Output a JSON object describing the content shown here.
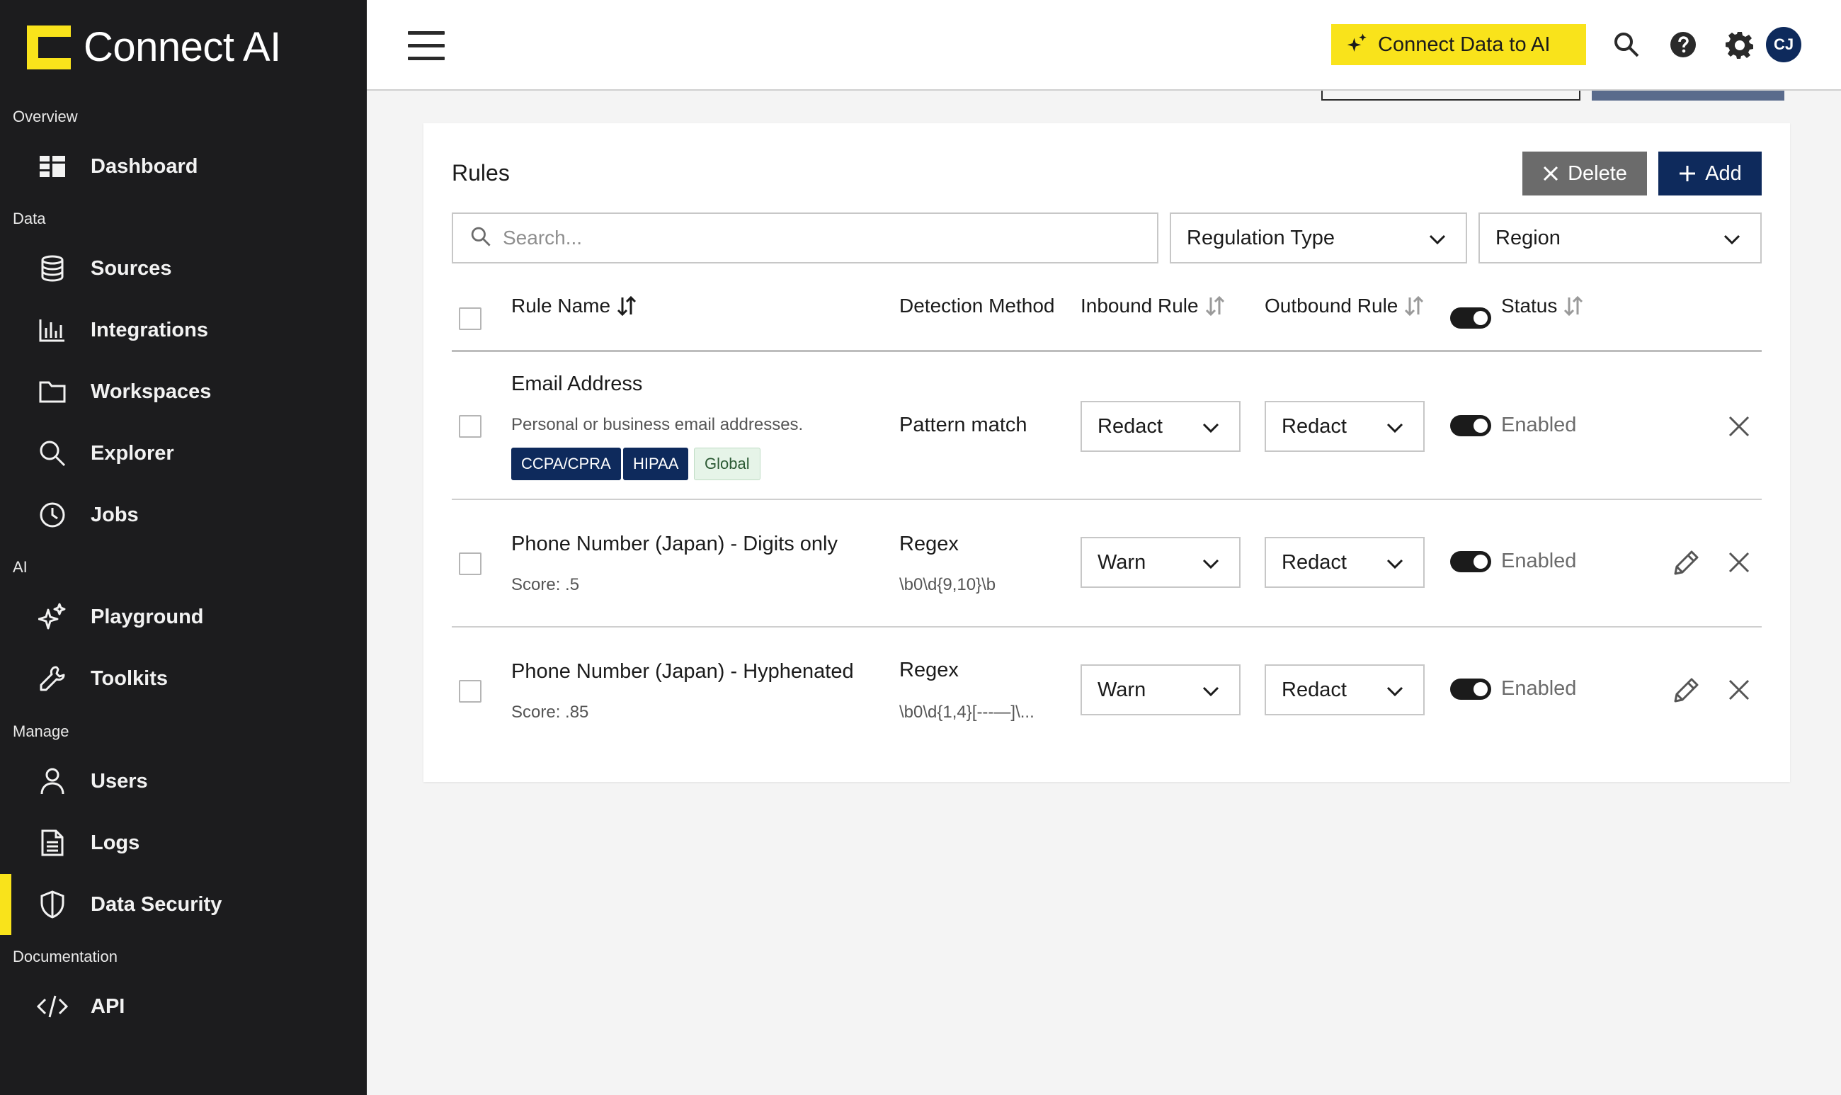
{
  "sidebar": {
    "brand": "Connect AI",
    "sections": {
      "overview": "Overview",
      "data": "Data",
      "ai": "AI",
      "manage": "Manage",
      "documentation": "Documentation"
    },
    "items": {
      "dashboard": "Dashboard",
      "sources": "Sources",
      "integrations": "Integrations",
      "workspaces": "Workspaces",
      "explorer": "Explorer",
      "jobs": "Jobs",
      "playground": "Playground",
      "toolkits": "Toolkits",
      "users": "Users",
      "logs": "Logs",
      "data_security": "Data Security",
      "api": "API"
    },
    "active": "data_security"
  },
  "topbar": {
    "connect_button": "Connect Data to AI",
    "avatar_initials": "CJ"
  },
  "colors": {
    "accent": "#f9e31b",
    "navy": "#0e2a5c",
    "sidebar_bg": "#1c1c1e"
  },
  "rules": {
    "title": "Rules",
    "delete_label": "Delete",
    "add_label": "Add",
    "search_placeholder": "Search...",
    "filter_regulation": "Regulation Type",
    "filter_region": "Region",
    "columns": {
      "rule_name": "Rule Name",
      "detection_method": "Detection Method",
      "inbound_rule": "Inbound Rule",
      "outbound_rule": "Outbound Rule",
      "status": "Status"
    },
    "rows": [
      {
        "name": "Email Address",
        "description": "Personal or business email addresses.",
        "tags": [
          "CCPA/CPRA",
          "HIPAA",
          "Global"
        ],
        "detection": "Pattern match",
        "inbound": "Redact",
        "outbound": "Redact",
        "status": "Enabled"
      },
      {
        "name": "Phone Number (Japan) - Digits only",
        "score": "Score: .5",
        "detection": "Regex",
        "pattern": "\\b0\\d{9,10}\\b",
        "inbound": "Warn",
        "outbound": "Redact",
        "status": "Enabled"
      },
      {
        "name": "Phone Number (Japan) - Hyphenated",
        "score": "Score: .85",
        "detection": "Regex",
        "pattern": "\\b0\\d{1,4}[-‐‑—]\\...",
        "inbound": "Warn",
        "outbound": "Redact",
        "status": "Enabled"
      }
    ]
  }
}
